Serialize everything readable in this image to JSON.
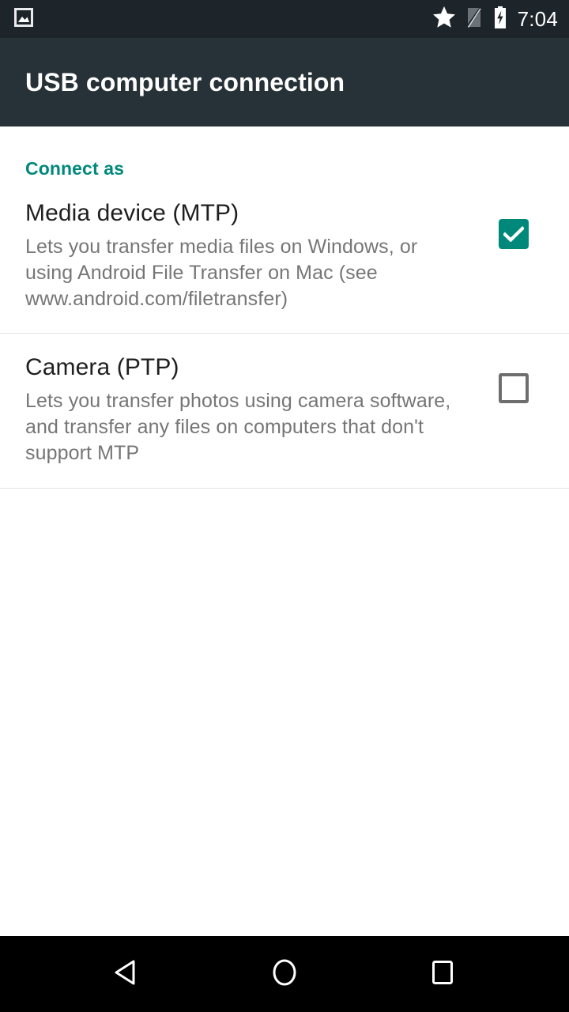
{
  "status_bar": {
    "notification_icons": [
      "image-icon"
    ],
    "system_icons": [
      "star-icon",
      "signal-off-icon",
      "battery-charging-icon"
    ],
    "clock": "7:04",
    "background_color": "#1d252b",
    "foreground_color": "#ffffff"
  },
  "action_bar": {
    "title": "USB computer connection",
    "background_color": "#263238",
    "title_color": "#ffffff"
  },
  "content": {
    "section_header": "Connect as",
    "accent_color": "#00897b",
    "options": [
      {
        "title": "Media device (MTP)",
        "summary": "Lets you transfer media files on Windows, or using Android File Transfer on Mac (see www.android.com/filetransfer)",
        "checked": true,
        "checkbox_state": "checked"
      },
      {
        "title": "Camera (PTP)",
        "summary": "Lets you transfer photos using camera software, and transfer any files on computers that don't support MTP",
        "checked": false,
        "checkbox_state": "unchecked"
      }
    ]
  },
  "nav_bar": {
    "background_color": "#000000",
    "buttons": [
      {
        "name": "back-button",
        "icon": "triangle-left-icon"
      },
      {
        "name": "home-button",
        "icon": "circle-icon"
      },
      {
        "name": "recents-button",
        "icon": "square-icon"
      }
    ]
  }
}
